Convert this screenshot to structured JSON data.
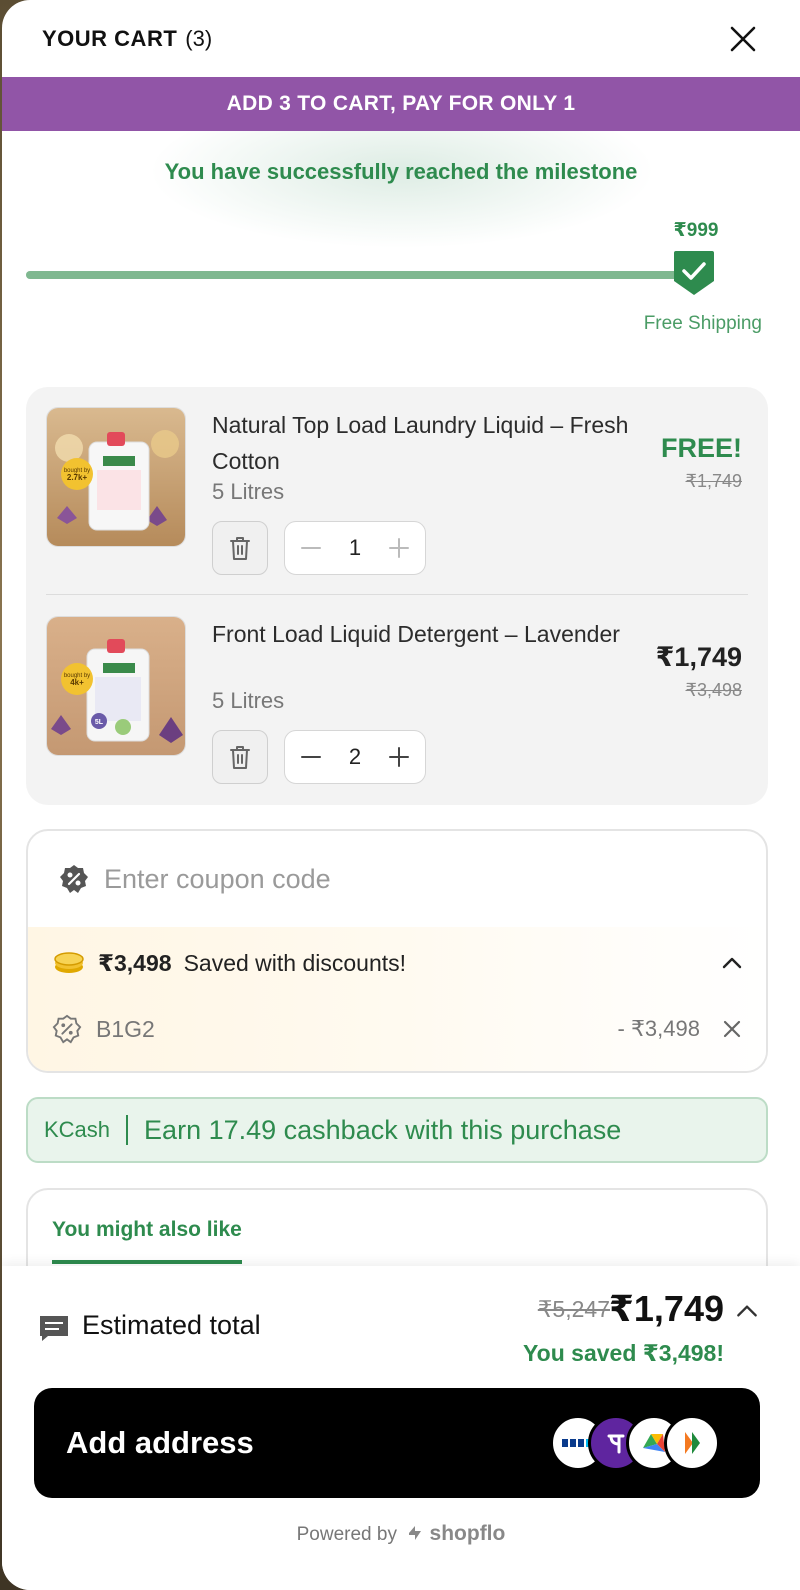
{
  "header": {
    "title": "YOUR CART",
    "count": "(3)"
  },
  "offer_banner": "ADD 3 TO CART, PAY FOR ONLY 1",
  "milestone": {
    "message": "You have successfully reached the milestone",
    "price": "₹999",
    "label": "Free Shipping",
    "progress": 1.0
  },
  "items": [
    {
      "name": "Natural Top Load Laundry Liquid – Fresh Cotton",
      "variant": "5 Litres",
      "quantity": "1",
      "price": "FREE!",
      "original_price": "₹1,749",
      "badge_text": "bought by 2.7k+ families"
    },
    {
      "name": "Front Load Liquid Detergent – Lavender",
      "variant": "5 Litres",
      "quantity": "2",
      "price": "₹1,749",
      "original_price": "₹3,498",
      "badge_text": "bought by 4k+ families"
    }
  ],
  "coupon": {
    "placeholder": "Enter coupon code",
    "saved_amount": "₹3,498",
    "saved_text": "Saved with discounts!",
    "applied_code": "B1G2",
    "applied_value": "- ₹3,498"
  },
  "kcash": {
    "label": "KCash",
    "text": "Earn 17.49 cashback with this purchase"
  },
  "recommendations": {
    "tab_label": "You might also like"
  },
  "footer": {
    "estimated_label": "Estimated total",
    "original_total": "₹5,247",
    "total": "₹1,749",
    "saved_text": "You saved ₹3,498!",
    "cta_label": "Add address",
    "powered_prefix": "Powered by",
    "powered_brand": "shopflo"
  },
  "colors": {
    "accent_green": "#2e8b4e",
    "banner_purple": "#9155a7",
    "cta_black": "#000000"
  },
  "icons": [
    "close-icon",
    "check-shield-icon",
    "trash-icon",
    "minus-icon",
    "plus-icon",
    "coupon-percent-icon",
    "coins-icon",
    "chevron-up-icon",
    "receipt-icon",
    "paytm-icon",
    "phonepe-icon",
    "gpay-icon",
    "bhim-icon"
  ]
}
